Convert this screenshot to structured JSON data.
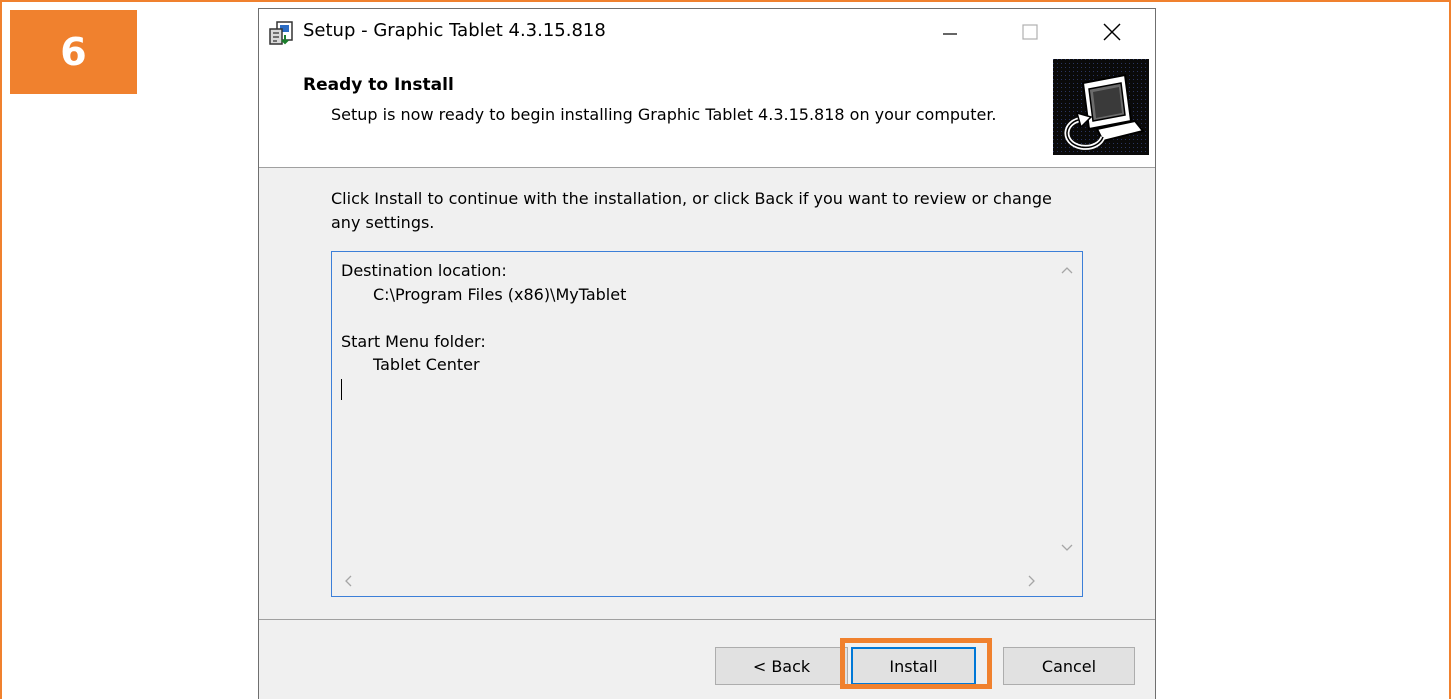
{
  "step": {
    "number": "6"
  },
  "window": {
    "title": "Setup - Graphic Tablet 4.3.15.818"
  },
  "header": {
    "title": "Ready to Install",
    "subtitle": "Setup is now ready to begin installing Graphic Tablet 4.3.15.818 on your computer."
  },
  "body": {
    "instruction": "Click Install to continue with the installation, or click Back if you want to review or change any settings."
  },
  "memo": {
    "destination_label": "Destination location:",
    "destination_value": "C:\\Program Files (x86)\\MyTablet",
    "start_menu_label": "Start Menu folder:",
    "start_menu_value": "Tablet Center"
  },
  "buttons": {
    "back": "< Back",
    "install": "Install",
    "cancel": "Cancel"
  },
  "colors": {
    "accent_orange": "#f0812e",
    "focus_blue": "#0078d7",
    "memo_border": "#3c7fd8",
    "dialog_bg": "#f0f0f0"
  },
  "icons": {
    "app": "installer-icon",
    "header": "computer-install-icon",
    "minimize": "minimize-icon",
    "maximize": "maximize-icon",
    "close": "close-icon"
  }
}
